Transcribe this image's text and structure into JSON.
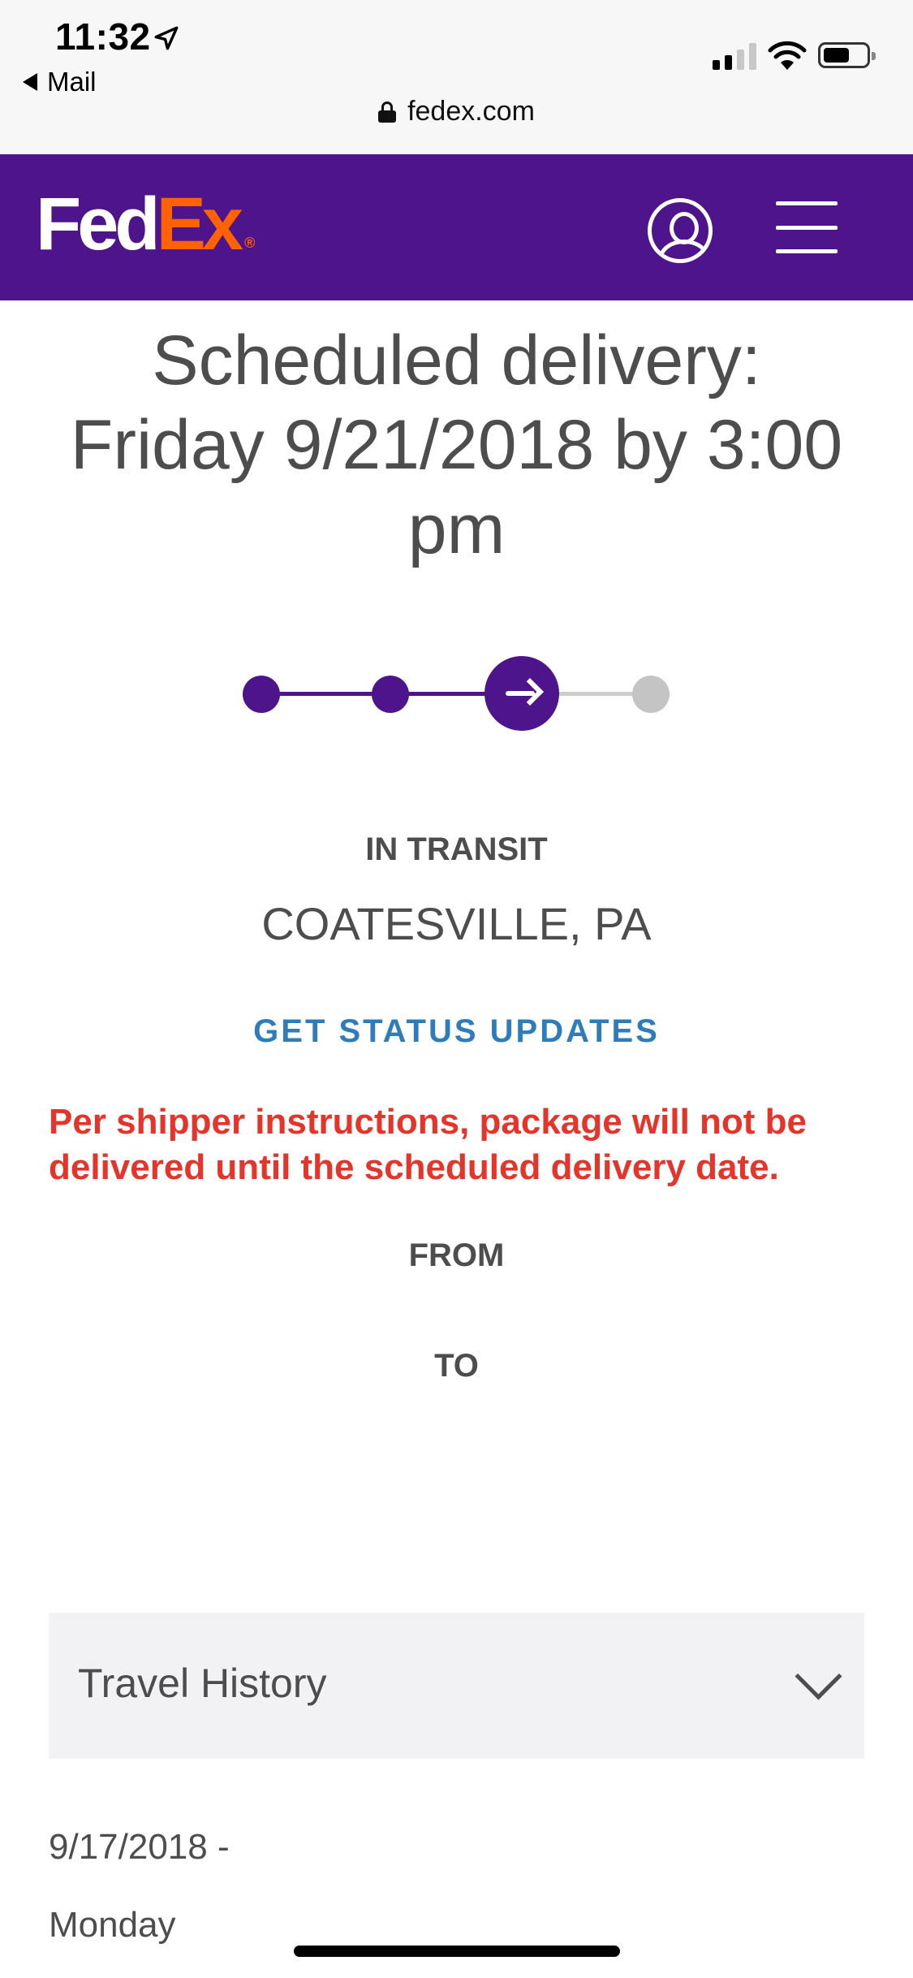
{
  "status_bar": {
    "time": "11:32",
    "back_label": "Mail",
    "url": "fedex.com"
  },
  "header": {
    "logo_fed": "Fed",
    "logo_ex": "Ex",
    "logo_reg": "®",
    "colors": {
      "purple": "#4d148c",
      "orange": "#ff6200"
    }
  },
  "shipment": {
    "scheduled_line1": "Scheduled delivery:",
    "scheduled_line2": "Friday 9/21/2018 by 3:00 pm",
    "progress": {
      "steps_total": 4,
      "current_step": 3
    },
    "status": "IN TRANSIT",
    "location": "COATESVILLE, PA",
    "updates_link": "GET STATUS UPDATES",
    "notice": "Per shipper instructions, package will not be delivered until the scheduled delivery date.",
    "from_label": "FROM",
    "to_label": "TO"
  },
  "travel_history": {
    "label": "Travel History",
    "date": "9/17/2018 -",
    "day": "Monday"
  }
}
